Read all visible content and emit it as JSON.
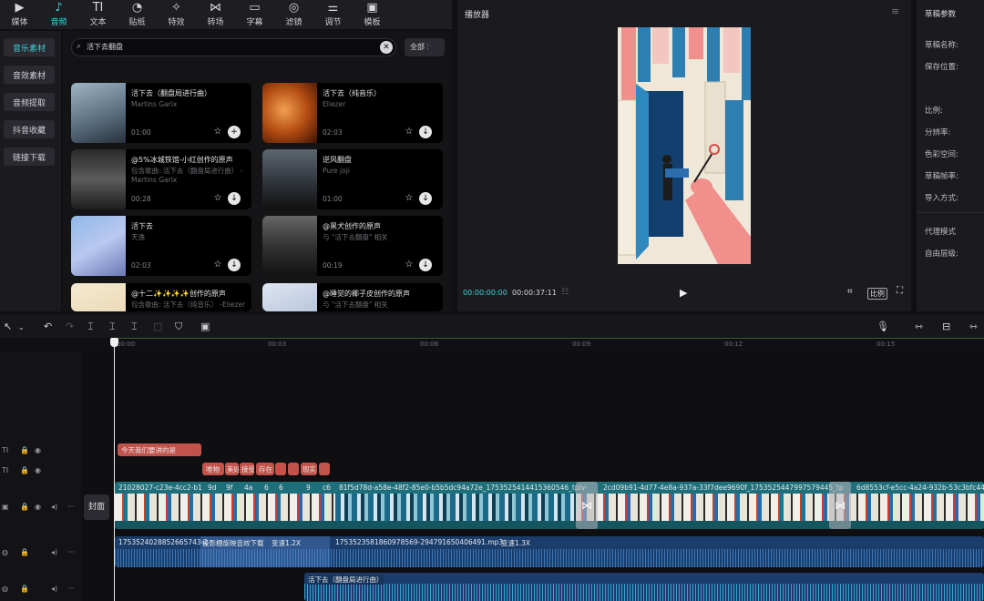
{
  "toolbar": {
    "tabs": [
      {
        "label": "媒体",
        "icon": "▶"
      },
      {
        "label": "音频",
        "icon": "♪"
      },
      {
        "label": "文本",
        "icon": "TI"
      },
      {
        "label": "贴纸",
        "icon": "◔"
      },
      {
        "label": "特效",
        "icon": "✧"
      },
      {
        "label": "转场",
        "icon": "⋈"
      },
      {
        "label": "字幕",
        "icon": "▭"
      },
      {
        "label": "滤镜",
        "icon": "◎"
      },
      {
        "label": "调节",
        "icon": "⚌"
      },
      {
        "label": "模板",
        "icon": "▣"
      }
    ]
  },
  "leftnav": {
    "items": [
      "音乐素材",
      "音效素材",
      "音频提取",
      "抖音收藏",
      "链接下载"
    ]
  },
  "search": {
    "value": "活下去翻盘",
    "filter_label": "全部"
  },
  "cards": [
    {
      "title": "活下去（翻盘局进行曲）",
      "sub": "Martins Garix",
      "sub2": "",
      "dur": "01:00",
      "action": "+"
    },
    {
      "title": "活下去（纯音乐）",
      "sub": "Eliezer",
      "sub2": "",
      "dur": "02:03",
      "action": "↓"
    },
    {
      "title": "@5%冰城铁馆-小红创作的原声",
      "sub": "包含歌曲: 活下去（翻盘局进行曲） -",
      "sub2": "Martins Garix",
      "dur": "00:28",
      "action": "↓"
    },
    {
      "title": "逆风翻盘",
      "sub": "Pure joji",
      "sub2": "",
      "dur": "01:00",
      "action": "↓"
    },
    {
      "title": "活下去",
      "sub": "天逸",
      "sub2": "",
      "dur": "02:03",
      "action": "↓"
    },
    {
      "title": "@黑犬创作的原声",
      "sub": "与 \"活下去翻盘\" 相关",
      "sub2": "",
      "dur": "00:19",
      "action": "↓"
    },
    {
      "title": "@十二✨✨✨✨创作的原声",
      "sub": "包含歌曲: 活下去（纯音乐） -Eliezer",
      "sub2": "",
      "dur": "",
      "action": ""
    },
    {
      "title": "@睡觉的椰子皮创作的原声",
      "sub": "与 \"活下去翻盘\" 相关",
      "sub2": "",
      "dur": "",
      "action": ""
    }
  ],
  "player": {
    "title": "播放器",
    "current_time": "00:00:00:00",
    "total_time": "00:00:37:11",
    "ratio_label": "比例"
  },
  "draft": {
    "title": "草稿参数",
    "labels": [
      "草稿名称:",
      "保存位置:",
      "比例:",
      "分辨率:",
      "色彩空间:",
      "草稿帧率:",
      "导入方式:",
      "代理模式",
      "自由层级:"
    ]
  },
  "timeline": {
    "ruler": [
      "00:00",
      "00:03",
      "00:06",
      "00:09",
      "00:12",
      "00:15"
    ],
    "cover_label": "封面",
    "text_clip": "今天我们要讲的是",
    "sub_clips": [
      "唯物",
      "美好",
      "接受",
      "存在",
      "",
      "",
      "现实",
      ""
    ],
    "video_clips": [
      "21028027-c23e-4cc2-b1",
      "9d",
      "9f",
      "4a",
      "6",
      "6",
      "9",
      "c6",
      "81f5d78d-a58e-48f2-85e0-b5b5dc94a72e_1753525414415360546_tplv-",
      "2cd09b91-4d77-4e8a-937a-33f7dee9690f_1753525447997579445_tp",
      "6d8553cf-e5cc-4a24-932b-53c3bfc446"
    ],
    "audio_clips": [
      {
        "name": "1753524028852665743-2",
        "speed": ""
      },
      {
        "name": "投影棚旋映音效下载",
        "speed": "变速1.2X"
      },
      {
        "name": "1753523581860978569-294791650406491.mp3",
        "speed": "变速1.3X"
      }
    ],
    "music_clip": "活下去（翻盘局进行曲）"
  },
  "colors": {
    "accent": "#3fd1d8",
    "text_clip": "#c2534a",
    "video_track": "#1d6f7a",
    "audio_track": "#1b3d6b"
  }
}
